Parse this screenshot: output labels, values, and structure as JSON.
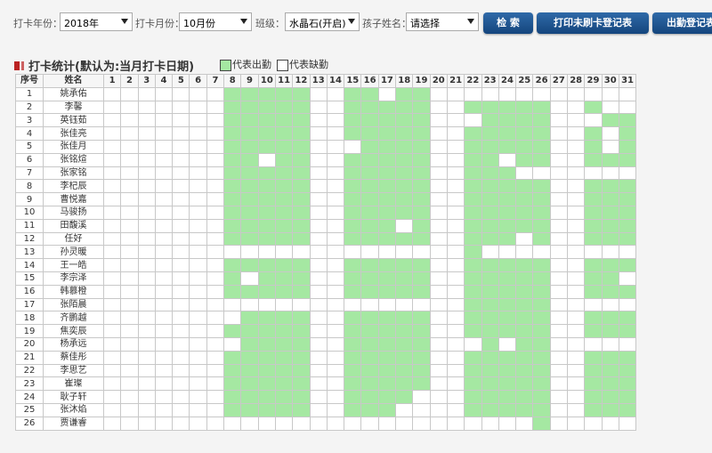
{
  "filters": {
    "year_label": "打卡年份：",
    "year_value": "2018年",
    "month_label": "打卡月份：",
    "month_value": "10月份",
    "class_label": "班级：",
    "class_value": "水晶石(开启)",
    "child_label": "孩子姓名：",
    "child_value": "请选择"
  },
  "buttons": {
    "search": "检 索",
    "print_unpunched": "打印未刷卡登记表",
    "attendance_register": "出勤登记表"
  },
  "section": {
    "title": "打卡统计(默认为:当月打卡日期)",
    "legend_present": "代表出勤",
    "legend_absent": "代表缺勤"
  },
  "colors": {
    "present": "#a5e8a2",
    "absent": "#ffffff",
    "button": "#1e5591",
    "title_mark": "#bb2222"
  },
  "table": {
    "header_index": "序号",
    "header_name": "姓名",
    "days": [
      "1",
      "2",
      "3",
      "4",
      "5",
      "6",
      "7",
      "8",
      "9",
      "10",
      "11",
      "12",
      "13",
      "14",
      "15",
      "16",
      "17",
      "18",
      "19",
      "20",
      "21",
      "22",
      "23",
      "24",
      "25",
      "26",
      "27",
      "28",
      "29",
      "30",
      "31"
    ],
    "rows": [
      {
        "index": "1",
        "name": "姚承佑",
        "present": [
          8,
          9,
          10,
          11,
          12,
          15,
          16,
          18,
          19
        ]
      },
      {
        "index": "2",
        "name": "李馨",
        "present": [
          8,
          9,
          10,
          11,
          12,
          15,
          16,
          17,
          18,
          19,
          22,
          23,
          24,
          25,
          26,
          29
        ]
      },
      {
        "index": "3",
        "name": "英钰茹",
        "present": [
          8,
          9,
          10,
          11,
          12,
          15,
          16,
          17,
          18,
          19,
          23,
          24,
          25,
          26,
          30,
          31
        ]
      },
      {
        "index": "4",
        "name": "张佳亮",
        "present": [
          8,
          9,
          10,
          11,
          12,
          15,
          16,
          17,
          18,
          19,
          22,
          23,
          24,
          25,
          26,
          29,
          31
        ]
      },
      {
        "index": "5",
        "name": "张佳月",
        "present": [
          8,
          9,
          10,
          11,
          12,
          16,
          17,
          18,
          19,
          22,
          23,
          24,
          25,
          26,
          29,
          31
        ]
      },
      {
        "index": "6",
        "name": "张铭煊",
        "present": [
          8,
          9,
          11,
          12,
          15,
          16,
          17,
          18,
          19,
          22,
          23,
          25,
          26,
          29,
          30,
          31
        ]
      },
      {
        "index": "7",
        "name": "张家铭",
        "present": [
          8,
          9,
          10,
          11,
          12,
          15,
          16,
          17,
          18,
          19,
          22,
          23,
          24
        ]
      },
      {
        "index": "8",
        "name": "李杞辰",
        "present": [
          8,
          9,
          10,
          11,
          12,
          15,
          16,
          17,
          18,
          19,
          22,
          23,
          24,
          25,
          26,
          29,
          30,
          31
        ]
      },
      {
        "index": "9",
        "name": "曹悦嘉",
        "present": [
          8,
          9,
          10,
          11,
          12,
          15,
          16,
          17,
          18,
          19,
          22,
          23,
          24,
          25,
          26,
          29,
          30,
          31
        ]
      },
      {
        "index": "10",
        "name": "马骏扬",
        "present": [
          8,
          9,
          10,
          11,
          12,
          15,
          16,
          17,
          18,
          19,
          22,
          23,
          24,
          25,
          26,
          29,
          30,
          31
        ]
      },
      {
        "index": "11",
        "name": "田馥溪",
        "present": [
          8,
          9,
          10,
          11,
          12,
          15,
          16,
          17,
          19,
          22,
          23,
          24,
          25,
          26,
          29,
          30,
          31
        ]
      },
      {
        "index": "12",
        "name": "任好",
        "present": [
          8,
          9,
          10,
          11,
          12,
          15,
          16,
          17,
          18,
          19,
          22,
          23,
          24,
          26,
          29,
          30,
          31
        ]
      },
      {
        "index": "13",
        "name": "孙灵暖",
        "present": [
          22
        ]
      },
      {
        "index": "14",
        "name": "王一皓",
        "present": [
          8,
          9,
          10,
          11,
          12,
          15,
          16,
          17,
          18,
          19,
          22,
          23,
          24,
          25,
          26,
          29,
          30,
          31
        ]
      },
      {
        "index": "15",
        "name": "李宗泽",
        "present": [
          8,
          10,
          11,
          12,
          15,
          16,
          17,
          18,
          19,
          22,
          23,
          24,
          25,
          26,
          29,
          30
        ]
      },
      {
        "index": "16",
        "name": "韩慕橙",
        "present": [
          8,
          9,
          10,
          11,
          12,
          15,
          16,
          17,
          18,
          19,
          22,
          23,
          24,
          25,
          26,
          29,
          30,
          31
        ]
      },
      {
        "index": "17",
        "name": "张陌晨",
        "present": [
          22,
          23,
          24,
          25,
          26
        ]
      },
      {
        "index": "18",
        "name": "齐鹏越",
        "present": [
          9,
          10,
          11,
          12,
          15,
          16,
          17,
          18,
          19,
          22,
          23,
          24,
          25,
          26,
          29,
          30,
          31
        ]
      },
      {
        "index": "19",
        "name": "焦奕辰",
        "present": [
          8,
          9,
          10,
          11,
          12,
          15,
          16,
          17,
          18,
          19,
          22,
          23,
          24,
          25,
          26,
          29,
          30,
          31
        ]
      },
      {
        "index": "20",
        "name": "杨承远",
        "present": [
          9,
          10,
          11,
          12,
          15,
          16,
          17,
          18,
          19,
          23,
          25,
          26
        ]
      },
      {
        "index": "21",
        "name": "蔡佳彤",
        "present": [
          8,
          9,
          10,
          11,
          12,
          15,
          16,
          17,
          18,
          19,
          22,
          23,
          24,
          25,
          26,
          29,
          30,
          31
        ]
      },
      {
        "index": "22",
        "name": "李思艺",
        "present": [
          8,
          9,
          10,
          11,
          12,
          15,
          16,
          17,
          18,
          19,
          22,
          23,
          24,
          25,
          26,
          29,
          30,
          31
        ]
      },
      {
        "index": "23",
        "name": "崔璨",
        "present": [
          8,
          9,
          10,
          11,
          12,
          15,
          16,
          17,
          18,
          19,
          22,
          23,
          24,
          25,
          26,
          29,
          30,
          31
        ]
      },
      {
        "index": "24",
        "name": "耿子轩",
        "present": [
          8,
          9,
          10,
          11,
          12,
          15,
          16,
          17,
          18,
          22,
          23,
          24,
          25,
          26,
          29,
          30,
          31
        ]
      },
      {
        "index": "25",
        "name": "张沐焰",
        "present": [
          8,
          9,
          10,
          11,
          12,
          15,
          16,
          17,
          22,
          23,
          24,
          25,
          26,
          29,
          30,
          31
        ]
      },
      {
        "index": "26",
        "name": "贾谦睿",
        "present": [
          26
        ]
      }
    ]
  }
}
